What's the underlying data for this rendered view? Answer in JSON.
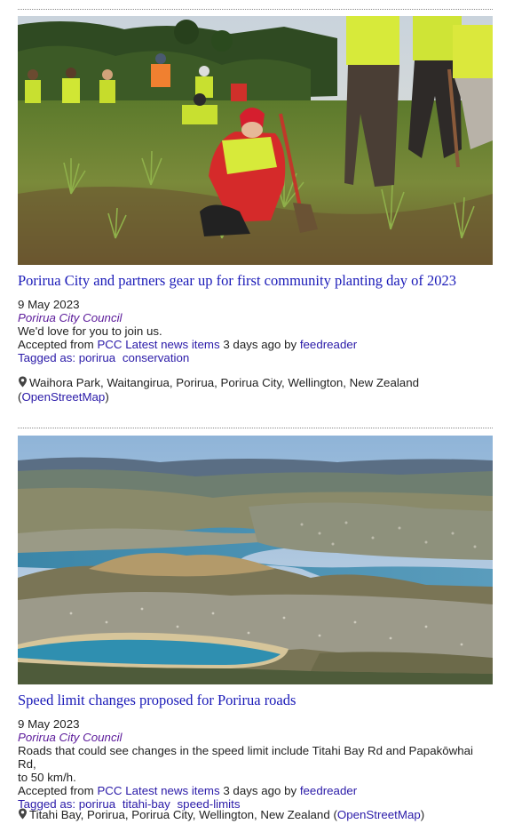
{
  "items": [
    {
      "title": "Porirua City and partners gear up for first community planting day of 2023",
      "date": "9 May 2023",
      "source": "Porirua City Council",
      "summary": "We'd love for you to join us.",
      "accepted_prefix": "Accepted from",
      "feed_link": "PCC Latest news items",
      "accepted_mid": "3 days ago by",
      "user_link": "feedreader",
      "tagged_label": "Tagged as:",
      "tags": [
        "porirua",
        "conservation"
      ],
      "location": "Waihora Park, Waitangirua, Porirua, Porirua City, Wellington, New Zealand",
      "osm_open": "(",
      "osm_link": "OpenStreetMap",
      "osm_close": ")"
    },
    {
      "title": "Speed limit changes proposed for Porirua roads",
      "date": "9 May 2023",
      "source": "Porirua City Council",
      "summary_line1": "Roads that could see changes in the speed limit include Titahi Bay Rd and Papakōwhai Rd,",
      "summary_line2": "to 50 km/h.",
      "accepted_prefix": "Accepted from",
      "feed_link": "PCC Latest news items",
      "accepted_mid": "3 days ago by",
      "user_link": "feedreader",
      "tagged_label": "Tagged as:",
      "tags": [
        "porirua",
        "titahi-bay",
        "speed-limits"
      ],
      "location": "Titahi Bay, Porirua, Porirua City, Wellington, New Zealand",
      "osm_open": "(",
      "osm_link": "OpenStreetMap",
      "osm_close": ")"
    }
  ],
  "icons": {
    "location": "map-pin-icon"
  },
  "colors": {
    "title_link": "#1a1ab8",
    "source": "#5b1a9a",
    "link": "#2a1aa8"
  }
}
